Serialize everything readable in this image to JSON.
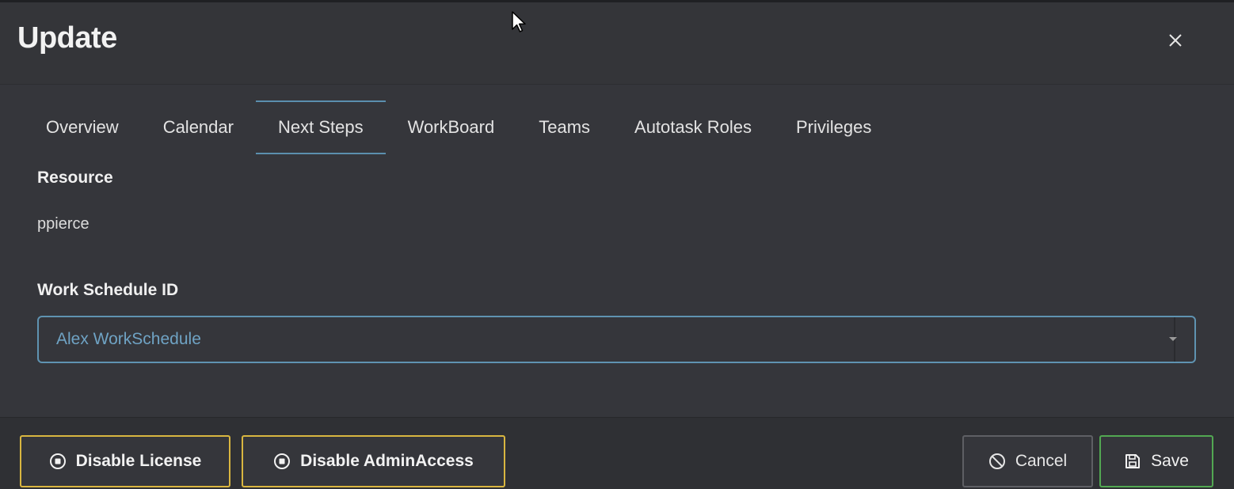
{
  "dialog": {
    "title": "Update",
    "close_icon": "close-icon"
  },
  "tabs": [
    {
      "label": "Overview",
      "active": false
    },
    {
      "label": "Calendar",
      "active": false
    },
    {
      "label": "Next Steps",
      "active": true
    },
    {
      "label": "WorkBoard",
      "active": false
    },
    {
      "label": "Teams",
      "active": false
    },
    {
      "label": "Autotask Roles",
      "active": false
    },
    {
      "label": "Privileges",
      "active": false
    }
  ],
  "form": {
    "resource_label": "Resource",
    "resource_value": "ppierce",
    "work_schedule_label": "Work Schedule ID",
    "work_schedule_value": "Alex WorkSchedule"
  },
  "footer": {
    "disable_license_label": "Disable License",
    "disable_admin_label": "Disable AdminAccess",
    "cancel_label": "Cancel",
    "save_label": "Save"
  },
  "colors": {
    "background": "#35363b",
    "accent": "#5f93b1",
    "warning_border": "#d9b640",
    "save_border": "#52a852"
  }
}
